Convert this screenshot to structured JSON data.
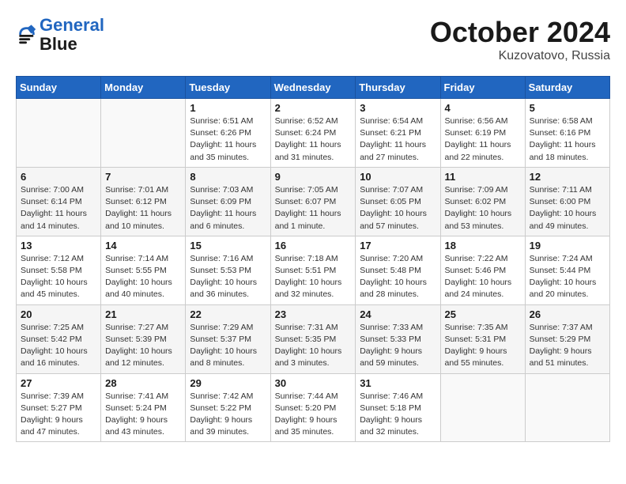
{
  "header": {
    "logo_line1": "General",
    "logo_line2": "Blue",
    "month_year": "October 2024",
    "location": "Kuzovatovo, Russia"
  },
  "weekdays": [
    "Sunday",
    "Monday",
    "Tuesday",
    "Wednesday",
    "Thursday",
    "Friday",
    "Saturday"
  ],
  "weeks": [
    [
      {
        "day": "",
        "sunrise": "",
        "sunset": "",
        "daylight": ""
      },
      {
        "day": "",
        "sunrise": "",
        "sunset": "",
        "daylight": ""
      },
      {
        "day": "1",
        "sunrise": "Sunrise: 6:51 AM",
        "sunset": "Sunset: 6:26 PM",
        "daylight": "Daylight: 11 hours and 35 minutes."
      },
      {
        "day": "2",
        "sunrise": "Sunrise: 6:52 AM",
        "sunset": "Sunset: 6:24 PM",
        "daylight": "Daylight: 11 hours and 31 minutes."
      },
      {
        "day": "3",
        "sunrise": "Sunrise: 6:54 AM",
        "sunset": "Sunset: 6:21 PM",
        "daylight": "Daylight: 11 hours and 27 minutes."
      },
      {
        "day": "4",
        "sunrise": "Sunrise: 6:56 AM",
        "sunset": "Sunset: 6:19 PM",
        "daylight": "Daylight: 11 hours and 22 minutes."
      },
      {
        "day": "5",
        "sunrise": "Sunrise: 6:58 AM",
        "sunset": "Sunset: 6:16 PM",
        "daylight": "Daylight: 11 hours and 18 minutes."
      }
    ],
    [
      {
        "day": "6",
        "sunrise": "Sunrise: 7:00 AM",
        "sunset": "Sunset: 6:14 PM",
        "daylight": "Daylight: 11 hours and 14 minutes."
      },
      {
        "day": "7",
        "sunrise": "Sunrise: 7:01 AM",
        "sunset": "Sunset: 6:12 PM",
        "daylight": "Daylight: 11 hours and 10 minutes."
      },
      {
        "day": "8",
        "sunrise": "Sunrise: 7:03 AM",
        "sunset": "Sunset: 6:09 PM",
        "daylight": "Daylight: 11 hours and 6 minutes."
      },
      {
        "day": "9",
        "sunrise": "Sunrise: 7:05 AM",
        "sunset": "Sunset: 6:07 PM",
        "daylight": "Daylight: 11 hours and 1 minute."
      },
      {
        "day": "10",
        "sunrise": "Sunrise: 7:07 AM",
        "sunset": "Sunset: 6:05 PM",
        "daylight": "Daylight: 10 hours and 57 minutes."
      },
      {
        "day": "11",
        "sunrise": "Sunrise: 7:09 AM",
        "sunset": "Sunset: 6:02 PM",
        "daylight": "Daylight: 10 hours and 53 minutes."
      },
      {
        "day": "12",
        "sunrise": "Sunrise: 7:11 AM",
        "sunset": "Sunset: 6:00 PM",
        "daylight": "Daylight: 10 hours and 49 minutes."
      }
    ],
    [
      {
        "day": "13",
        "sunrise": "Sunrise: 7:12 AM",
        "sunset": "Sunset: 5:58 PM",
        "daylight": "Daylight: 10 hours and 45 minutes."
      },
      {
        "day": "14",
        "sunrise": "Sunrise: 7:14 AM",
        "sunset": "Sunset: 5:55 PM",
        "daylight": "Daylight: 10 hours and 40 minutes."
      },
      {
        "day": "15",
        "sunrise": "Sunrise: 7:16 AM",
        "sunset": "Sunset: 5:53 PM",
        "daylight": "Daylight: 10 hours and 36 minutes."
      },
      {
        "day": "16",
        "sunrise": "Sunrise: 7:18 AM",
        "sunset": "Sunset: 5:51 PM",
        "daylight": "Daylight: 10 hours and 32 minutes."
      },
      {
        "day": "17",
        "sunrise": "Sunrise: 7:20 AM",
        "sunset": "Sunset: 5:48 PM",
        "daylight": "Daylight: 10 hours and 28 minutes."
      },
      {
        "day": "18",
        "sunrise": "Sunrise: 7:22 AM",
        "sunset": "Sunset: 5:46 PM",
        "daylight": "Daylight: 10 hours and 24 minutes."
      },
      {
        "day": "19",
        "sunrise": "Sunrise: 7:24 AM",
        "sunset": "Sunset: 5:44 PM",
        "daylight": "Daylight: 10 hours and 20 minutes."
      }
    ],
    [
      {
        "day": "20",
        "sunrise": "Sunrise: 7:25 AM",
        "sunset": "Sunset: 5:42 PM",
        "daylight": "Daylight: 10 hours and 16 minutes."
      },
      {
        "day": "21",
        "sunrise": "Sunrise: 7:27 AM",
        "sunset": "Sunset: 5:39 PM",
        "daylight": "Daylight: 10 hours and 12 minutes."
      },
      {
        "day": "22",
        "sunrise": "Sunrise: 7:29 AM",
        "sunset": "Sunset: 5:37 PM",
        "daylight": "Daylight: 10 hours and 8 minutes."
      },
      {
        "day": "23",
        "sunrise": "Sunrise: 7:31 AM",
        "sunset": "Sunset: 5:35 PM",
        "daylight": "Daylight: 10 hours and 3 minutes."
      },
      {
        "day": "24",
        "sunrise": "Sunrise: 7:33 AM",
        "sunset": "Sunset: 5:33 PM",
        "daylight": "Daylight: 9 hours and 59 minutes."
      },
      {
        "day": "25",
        "sunrise": "Sunrise: 7:35 AM",
        "sunset": "Sunset: 5:31 PM",
        "daylight": "Daylight: 9 hours and 55 minutes."
      },
      {
        "day": "26",
        "sunrise": "Sunrise: 7:37 AM",
        "sunset": "Sunset: 5:29 PM",
        "daylight": "Daylight: 9 hours and 51 minutes."
      }
    ],
    [
      {
        "day": "27",
        "sunrise": "Sunrise: 7:39 AM",
        "sunset": "Sunset: 5:27 PM",
        "daylight": "Daylight: 9 hours and 47 minutes."
      },
      {
        "day": "28",
        "sunrise": "Sunrise: 7:41 AM",
        "sunset": "Sunset: 5:24 PM",
        "daylight": "Daylight: 9 hours and 43 minutes."
      },
      {
        "day": "29",
        "sunrise": "Sunrise: 7:42 AM",
        "sunset": "Sunset: 5:22 PM",
        "daylight": "Daylight: 9 hours and 39 minutes."
      },
      {
        "day": "30",
        "sunrise": "Sunrise: 7:44 AM",
        "sunset": "Sunset: 5:20 PM",
        "daylight": "Daylight: 9 hours and 35 minutes."
      },
      {
        "day": "31",
        "sunrise": "Sunrise: 7:46 AM",
        "sunset": "Sunset: 5:18 PM",
        "daylight": "Daylight: 9 hours and 32 minutes."
      },
      {
        "day": "",
        "sunrise": "",
        "sunset": "",
        "daylight": ""
      },
      {
        "day": "",
        "sunrise": "",
        "sunset": "",
        "daylight": ""
      }
    ]
  ]
}
